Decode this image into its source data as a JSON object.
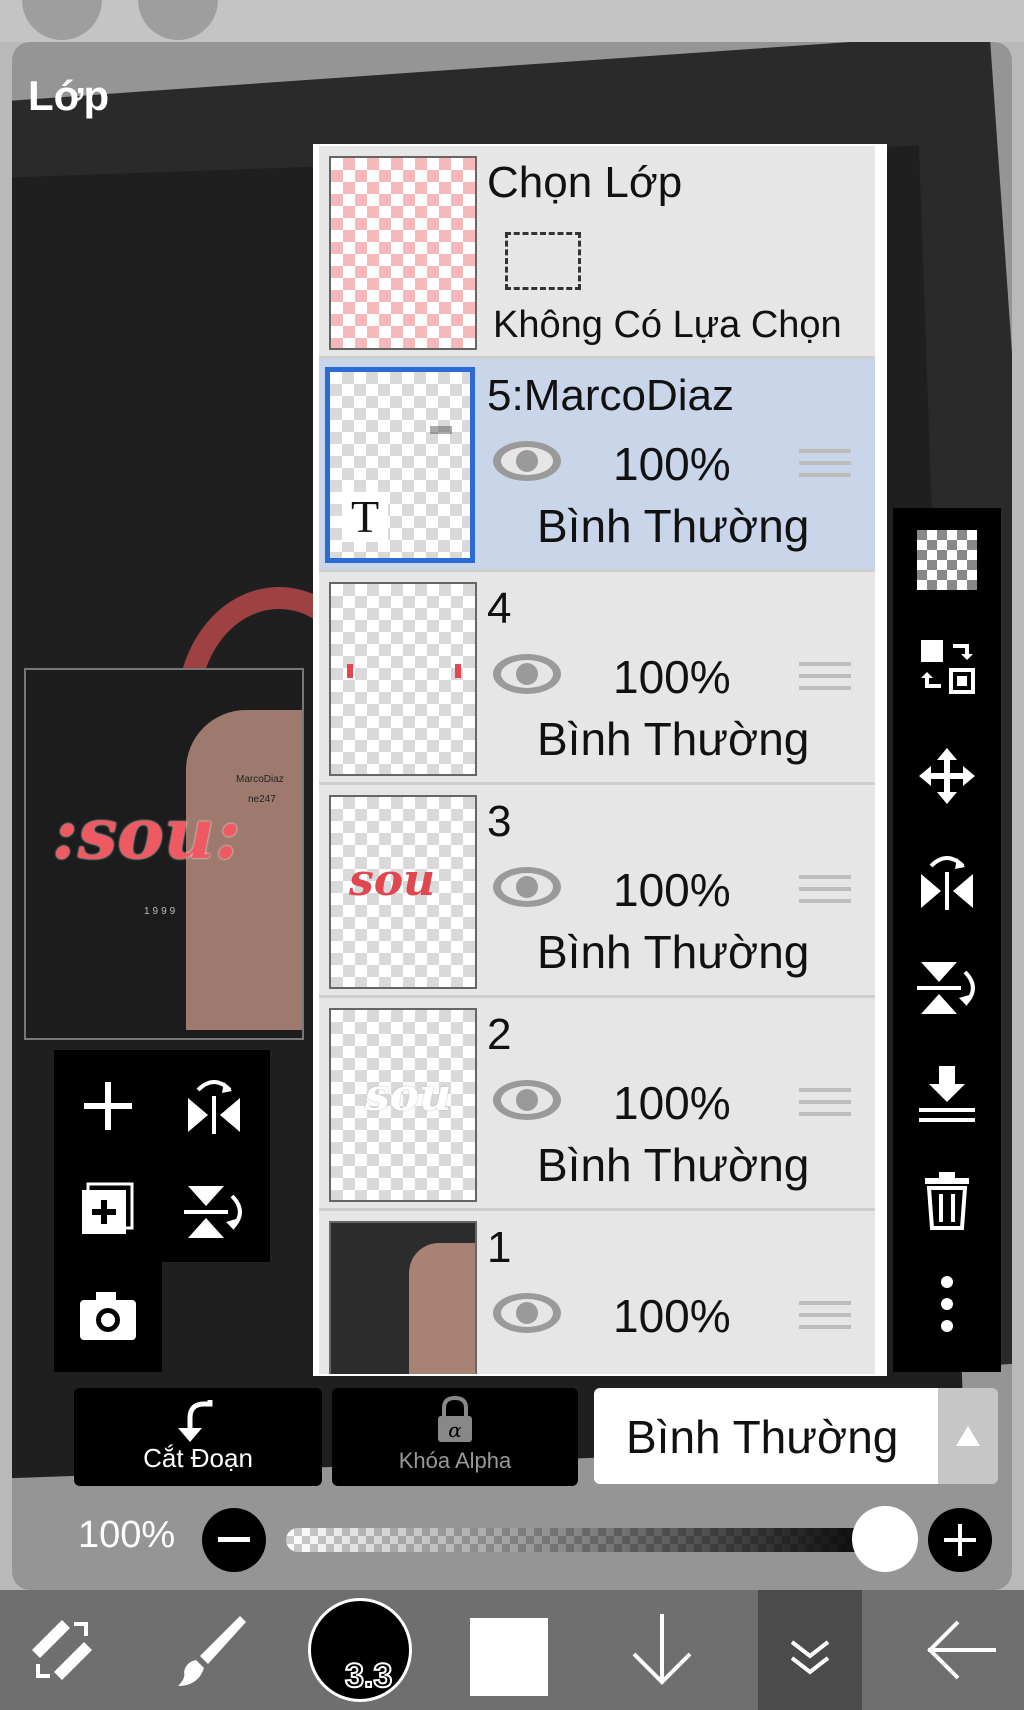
{
  "panel": {
    "title": "Lớp"
  },
  "selection_row": {
    "title": "Chọn Lớp",
    "status": "Không Có Lựa Chọn"
  },
  "layers": [
    {
      "name": "5:MarcoDiaz",
      "opacity": "100%",
      "blend": "Bình Thường",
      "selected": true,
      "thumb_label": "T"
    },
    {
      "name": "4",
      "opacity": "100%",
      "blend": "Bình Thường",
      "selected": false
    },
    {
      "name": "3",
      "opacity": "100%",
      "blend": "Bình Thường",
      "selected": false,
      "thumb_label": "sou"
    },
    {
      "name": "2",
      "opacity": "100%",
      "blend": "Bình Thường",
      "selected": false,
      "thumb_label": "sou"
    },
    {
      "name": "1",
      "opacity": "100%",
      "blend": "Bình Thường",
      "selected": false
    }
  ],
  "preview": {
    "text": ":sou:",
    "caption1": "MarcoDiaz",
    "caption2": "ne247",
    "year": "1999"
  },
  "layer1_thumb_text": "...",
  "actions": {
    "clipping": "Cắt Đoạn",
    "alpha_lock": "Khóa Alpha",
    "blend_mode": "Bình Thường"
  },
  "opacity": {
    "label": "100%",
    "value": 1.0
  },
  "brush": {
    "size": "3.3"
  },
  "colors": {
    "selected_border": "#2b6bd4",
    "selected_row": "#c9d6ea",
    "accent_red": "#e0474f"
  },
  "icons": {
    "right_toolbar": [
      "checker-icon",
      "swap-layers-icon",
      "move-icon",
      "flip-horizontal-icon",
      "flip-vertical-icon",
      "merge-down-icon",
      "trash-icon",
      "more-vertical-icon"
    ],
    "left_toolbar": [
      "add-layer-icon",
      "flip-horizontal-icon",
      "add-copy-icon",
      "flip-vertical-icon",
      "camera-icon"
    ],
    "bottom": [
      "transform-icon",
      "brush-icon",
      "brush-size-icon",
      "color-swatch-icon",
      "down-arrow-icon",
      "layers-collapse-icon",
      "back-arrow-icon"
    ]
  }
}
